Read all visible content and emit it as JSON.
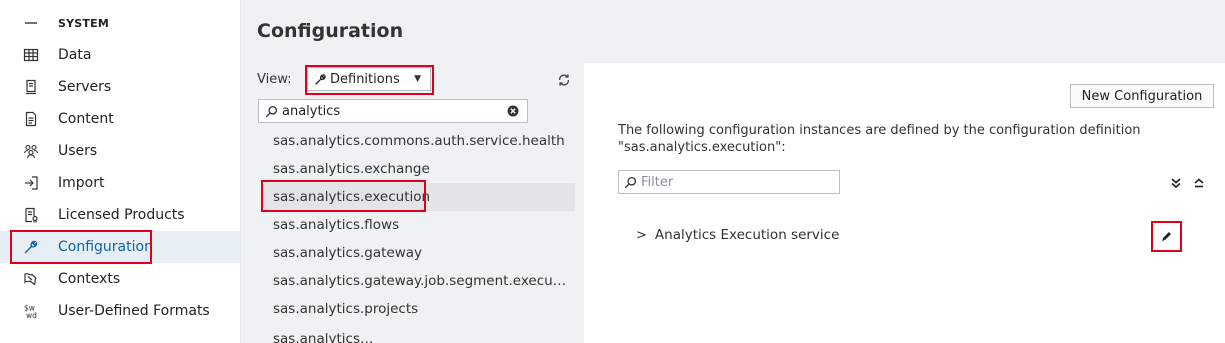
{
  "nav": {
    "header": {
      "label": "SYSTEM",
      "icon": "hamburger-icon"
    },
    "items": [
      {
        "label": "Data",
        "icon": "data-grid-icon"
      },
      {
        "label": "Servers",
        "icon": "server-icon"
      },
      {
        "label": "Content",
        "icon": "content-document-icon"
      },
      {
        "label": "Users",
        "icon": "users-icon"
      },
      {
        "label": "Import",
        "icon": "import-icon"
      },
      {
        "label": "Licensed Products",
        "icon": "licensed-products-icon"
      },
      {
        "label": "Configuration",
        "icon": "wrench-icon",
        "active": true
      },
      {
        "label": "Contexts",
        "icon": "contexts-icon"
      },
      {
        "label": "User-Defined Formats",
        "icon": "user-defined-formats-icon"
      }
    ]
  },
  "page": {
    "title": "Configuration"
  },
  "definitions": {
    "view_label": "View:",
    "view_value": "Definitions",
    "search_value": "analytics",
    "items": [
      "sas.analytics.commons.auth.service.health",
      "sas.analytics.exchange",
      "sas.analytics.execution",
      "sas.analytics.flows",
      "sas.analytics.gateway",
      "sas.analytics.gateway.job.segment.execu…",
      "sas.analytics.projects"
    ],
    "selected_index": 2
  },
  "detail": {
    "new_button": "New Configuration",
    "description_line1": "The following configuration instances are defined by the configuration definition",
    "description_line2": "\"sas.analytics.execution\":",
    "filter_placeholder": "Filter",
    "instance_chevron": ">",
    "instance_label": "Analytics Execution service"
  },
  "colors": {
    "accent": "#0b63a8",
    "highlight": "#e0001b",
    "selected_bg": "#e2e4e7",
    "panel_bg": "#f0f1f2"
  }
}
